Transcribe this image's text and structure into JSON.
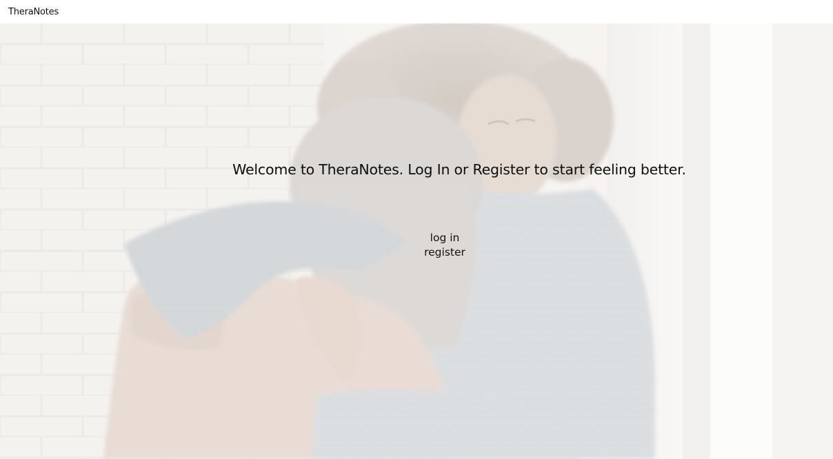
{
  "navbar": {
    "brand": "TheraNotes"
  },
  "hero": {
    "welcome_text": "Welcome to TheraNotes. Log In or Register to start feeling better.",
    "login_label": "log in",
    "register_label": "register",
    "photo_description_icon": "two-people-hugging-photo"
  }
}
